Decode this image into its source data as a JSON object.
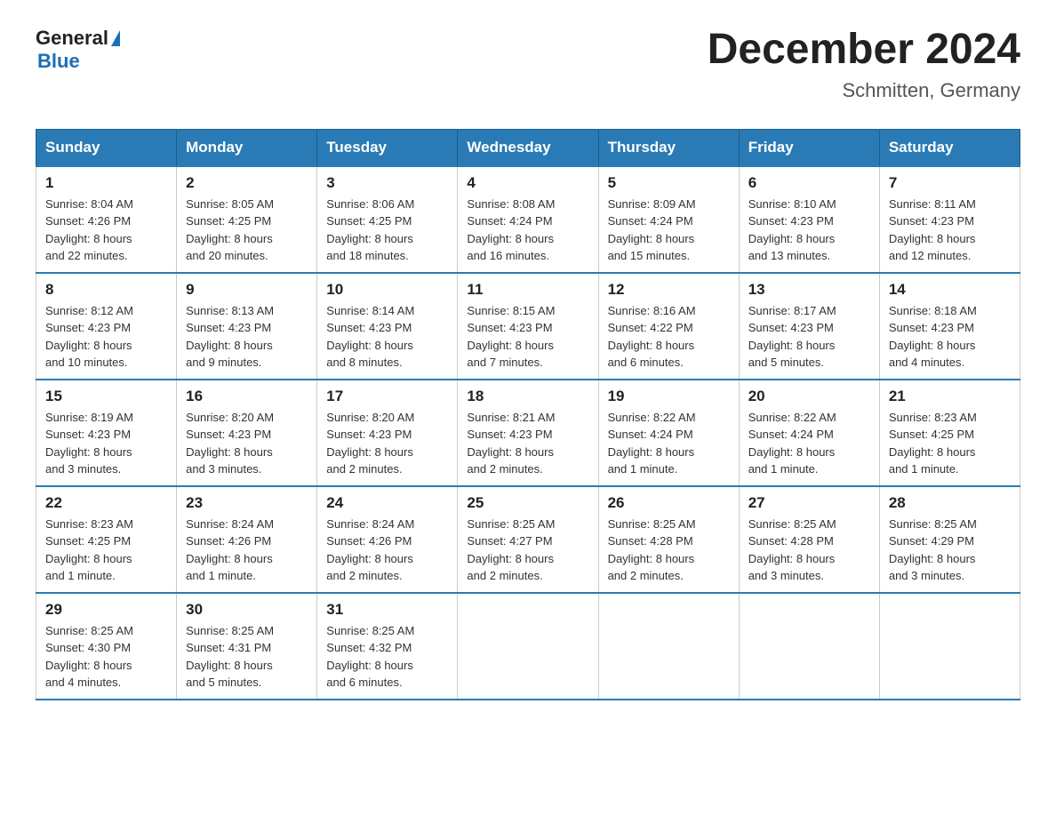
{
  "logo": {
    "general": "General",
    "blue": "Blue"
  },
  "header": {
    "month": "December 2024",
    "location": "Schmitten, Germany"
  },
  "days_of_week": [
    "Sunday",
    "Monday",
    "Tuesday",
    "Wednesday",
    "Thursday",
    "Friday",
    "Saturday"
  ],
  "weeks": [
    [
      {
        "day": "1",
        "sunrise": "8:04 AM",
        "sunset": "4:26 PM",
        "daylight": "8 hours and 22 minutes."
      },
      {
        "day": "2",
        "sunrise": "8:05 AM",
        "sunset": "4:25 PM",
        "daylight": "8 hours and 20 minutes."
      },
      {
        "day": "3",
        "sunrise": "8:06 AM",
        "sunset": "4:25 PM",
        "daylight": "8 hours and 18 minutes."
      },
      {
        "day": "4",
        "sunrise": "8:08 AM",
        "sunset": "4:24 PM",
        "daylight": "8 hours and 16 minutes."
      },
      {
        "day": "5",
        "sunrise": "8:09 AM",
        "sunset": "4:24 PM",
        "daylight": "8 hours and 15 minutes."
      },
      {
        "day": "6",
        "sunrise": "8:10 AM",
        "sunset": "4:23 PM",
        "daylight": "8 hours and 13 minutes."
      },
      {
        "day": "7",
        "sunrise": "8:11 AM",
        "sunset": "4:23 PM",
        "daylight": "8 hours and 12 minutes."
      }
    ],
    [
      {
        "day": "8",
        "sunrise": "8:12 AM",
        "sunset": "4:23 PM",
        "daylight": "8 hours and 10 minutes."
      },
      {
        "day": "9",
        "sunrise": "8:13 AM",
        "sunset": "4:23 PM",
        "daylight": "8 hours and 9 minutes."
      },
      {
        "day": "10",
        "sunrise": "8:14 AM",
        "sunset": "4:23 PM",
        "daylight": "8 hours and 8 minutes."
      },
      {
        "day": "11",
        "sunrise": "8:15 AM",
        "sunset": "4:23 PM",
        "daylight": "8 hours and 7 minutes."
      },
      {
        "day": "12",
        "sunrise": "8:16 AM",
        "sunset": "4:22 PM",
        "daylight": "8 hours and 6 minutes."
      },
      {
        "day": "13",
        "sunrise": "8:17 AM",
        "sunset": "4:23 PM",
        "daylight": "8 hours and 5 minutes."
      },
      {
        "day": "14",
        "sunrise": "8:18 AM",
        "sunset": "4:23 PM",
        "daylight": "8 hours and 4 minutes."
      }
    ],
    [
      {
        "day": "15",
        "sunrise": "8:19 AM",
        "sunset": "4:23 PM",
        "daylight": "8 hours and 3 minutes."
      },
      {
        "day": "16",
        "sunrise": "8:20 AM",
        "sunset": "4:23 PM",
        "daylight": "8 hours and 3 minutes."
      },
      {
        "day": "17",
        "sunrise": "8:20 AM",
        "sunset": "4:23 PM",
        "daylight": "8 hours and 2 minutes."
      },
      {
        "day": "18",
        "sunrise": "8:21 AM",
        "sunset": "4:23 PM",
        "daylight": "8 hours and 2 minutes."
      },
      {
        "day": "19",
        "sunrise": "8:22 AM",
        "sunset": "4:24 PM",
        "daylight": "8 hours and 1 minute."
      },
      {
        "day": "20",
        "sunrise": "8:22 AM",
        "sunset": "4:24 PM",
        "daylight": "8 hours and 1 minute."
      },
      {
        "day": "21",
        "sunrise": "8:23 AM",
        "sunset": "4:25 PM",
        "daylight": "8 hours and 1 minute."
      }
    ],
    [
      {
        "day": "22",
        "sunrise": "8:23 AM",
        "sunset": "4:25 PM",
        "daylight": "8 hours and 1 minute."
      },
      {
        "day": "23",
        "sunrise": "8:24 AM",
        "sunset": "4:26 PM",
        "daylight": "8 hours and 1 minute."
      },
      {
        "day": "24",
        "sunrise": "8:24 AM",
        "sunset": "4:26 PM",
        "daylight": "8 hours and 2 minutes."
      },
      {
        "day": "25",
        "sunrise": "8:25 AM",
        "sunset": "4:27 PM",
        "daylight": "8 hours and 2 minutes."
      },
      {
        "day": "26",
        "sunrise": "8:25 AM",
        "sunset": "4:28 PM",
        "daylight": "8 hours and 2 minutes."
      },
      {
        "day": "27",
        "sunrise": "8:25 AM",
        "sunset": "4:28 PM",
        "daylight": "8 hours and 3 minutes."
      },
      {
        "day": "28",
        "sunrise": "8:25 AM",
        "sunset": "4:29 PM",
        "daylight": "8 hours and 3 minutes."
      }
    ],
    [
      {
        "day": "29",
        "sunrise": "8:25 AM",
        "sunset": "4:30 PM",
        "daylight": "8 hours and 4 minutes."
      },
      {
        "day": "30",
        "sunrise": "8:25 AM",
        "sunset": "4:31 PM",
        "daylight": "8 hours and 5 minutes."
      },
      {
        "day": "31",
        "sunrise": "8:25 AM",
        "sunset": "4:32 PM",
        "daylight": "8 hours and 6 minutes."
      },
      null,
      null,
      null,
      null
    ]
  ],
  "labels": {
    "sunrise": "Sunrise:",
    "sunset": "Sunset:",
    "daylight": "Daylight:"
  }
}
